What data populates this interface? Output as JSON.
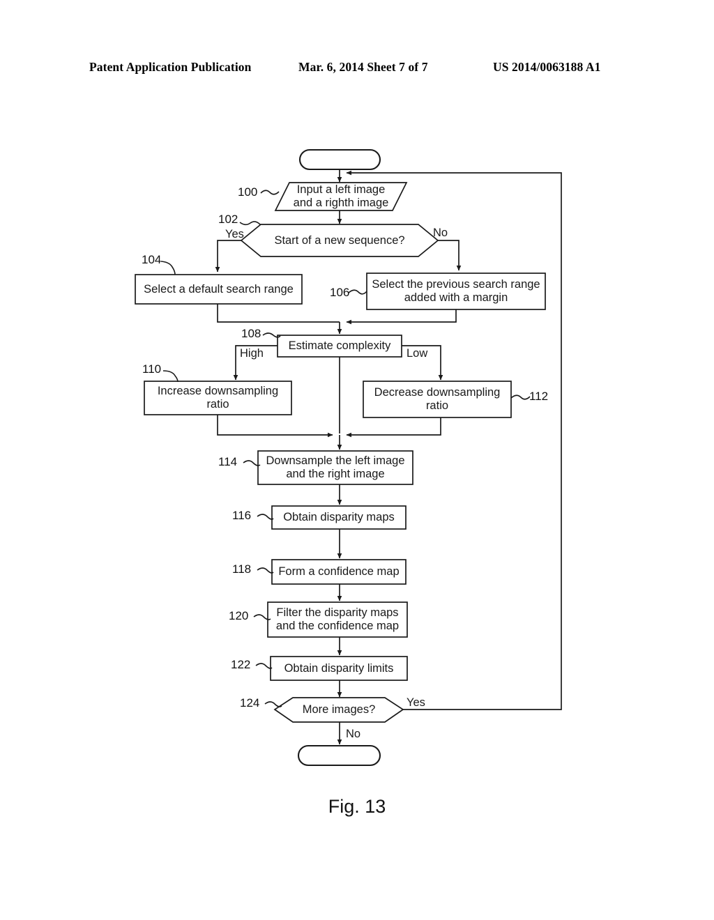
{
  "header": {
    "left": "Patent Application Publication",
    "middle": "Mar. 6, 2014  Sheet 7 of 7",
    "right": "US 2014/0063188 A1"
  },
  "figure": {
    "caption": "Fig. 13",
    "nodes": {
      "start": {
        "ref": "",
        "label": "",
        "shape": "terminator"
      },
      "n100": {
        "ref": "100",
        "label": "Input a left image\nand a righth image",
        "shape": "parallelogram"
      },
      "n102": {
        "ref": "102",
        "label": "Start of a new sequence?",
        "shape": "decision"
      },
      "n104": {
        "ref": "104",
        "label": "Select a default search range",
        "shape": "process"
      },
      "n106": {
        "ref": "106",
        "label": "Select the previous search range\nadded with a margin",
        "shape": "process"
      },
      "n108": {
        "ref": "108",
        "label": "Estimate complexity",
        "shape": "process"
      },
      "n110": {
        "ref": "110",
        "label": "Increase downsampling\nratio",
        "shape": "process"
      },
      "n112": {
        "ref": "112",
        "label": "Decrease downsampling\nratio",
        "shape": "process"
      },
      "n114": {
        "ref": "114",
        "label": "Downsample the left image\nand the right image",
        "shape": "process"
      },
      "n116": {
        "ref": "116",
        "label": "Obtain disparity maps",
        "shape": "process"
      },
      "n118": {
        "ref": "118",
        "label": "Form a confidence map",
        "shape": "process"
      },
      "n120": {
        "ref": "120",
        "label": "Filter the disparity maps\nand the confidence map",
        "shape": "process"
      },
      "n122": {
        "ref": "122",
        "label": "Obtain disparity limits",
        "shape": "process"
      },
      "n124": {
        "ref": "124",
        "label": "More images?",
        "shape": "decision"
      },
      "end": {
        "ref": "",
        "label": "",
        "shape": "terminator"
      }
    },
    "branch_labels": {
      "yes_102": "Yes",
      "no_102": "No",
      "high_108": "High",
      "low_108": "Low",
      "yes_124": "Yes",
      "no_124": "No"
    },
    "colors": {
      "stroke": "#1a1a1a",
      "background": "#ffffff",
      "text": "#1a1a1a"
    }
  }
}
